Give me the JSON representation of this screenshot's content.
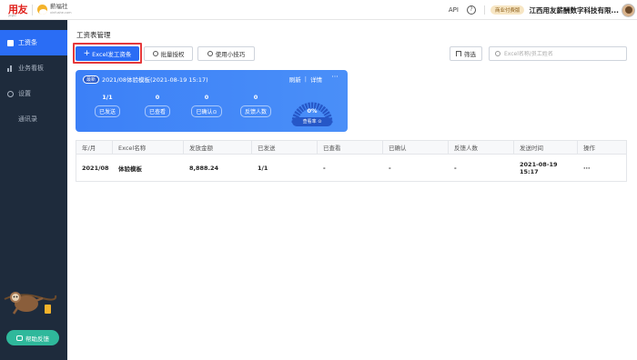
{
  "topbar": {
    "logo_text": "用友",
    "logo_sub": "yonyou",
    "brand_text": "薪福社",
    "brand_sub": "xinfushe.com",
    "api_label": "API",
    "help_symbol": "?",
    "plan_badge": "商业付费版",
    "company_name": "江西用友薪酬数字科技有限..."
  },
  "sidebar": {
    "items": [
      {
        "label": "工资条",
        "icon": "grid-icon",
        "active": true
      },
      {
        "label": "业务看板",
        "icon": "chart-icon",
        "active": false
      },
      {
        "label": "设置",
        "icon": "gear-icon",
        "active": false
      },
      {
        "label": "通讯录",
        "icon": "",
        "active": false
      }
    ],
    "help_button": "帮助反馈"
  },
  "main": {
    "page_title": "工资表管理",
    "toolbar": {
      "primary_label": "Excel发工资条",
      "batch_label": "批量授权",
      "tips_label": "使用小技巧",
      "filter_label": "筛选",
      "search_placeholder": "Excel名称/员工姓名"
    },
    "card": {
      "tag": "最新",
      "title": "2021/08体验模板(2021-08-19 15:17)",
      "refresh_label": "刷新",
      "details_label": "详情",
      "more_label": "···",
      "stats": [
        {
          "value": "1/1",
          "label": "已发送"
        },
        {
          "value": "0",
          "label": "已查看"
        },
        {
          "value": "0",
          "label": "已确认⊙"
        },
        {
          "value": "0",
          "label": "反馈人数"
        }
      ],
      "gauge_value": "0%",
      "gauge_label": "查看率 ⊙",
      "gauge_fraction": 0
    },
    "table": {
      "columns": [
        "年/月",
        "Excel名称",
        "发放金额",
        "已发送",
        "已查看",
        "已确认",
        "反馈人数",
        "发送时间",
        "操作"
      ],
      "rows": [
        [
          "2021/08",
          "体验模板",
          "8,888.24",
          "1/1",
          "-",
          "-",
          "-",
          "2021-08-19 15:17",
          "···"
        ]
      ]
    }
  }
}
